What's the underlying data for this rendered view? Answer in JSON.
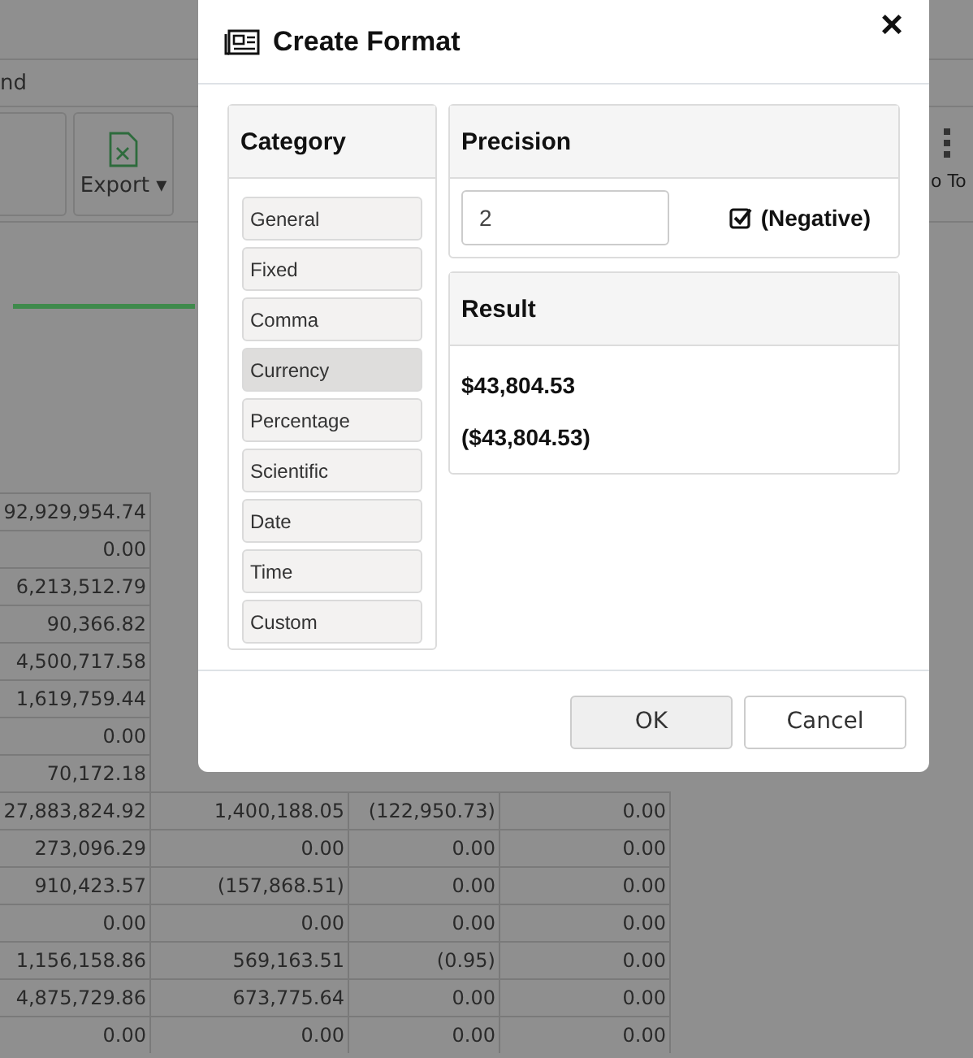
{
  "background": {
    "menu_text": "nd",
    "toolbar": {
      "export_label": "Export",
      "export_caret": "▾",
      "right_label": "o To"
    },
    "table": {
      "rows": [
        [
          "92,929,954.74"
        ],
        [
          "0.00"
        ],
        [
          "6,213,512.79"
        ],
        [
          "90,366.82"
        ],
        [
          "4,500,717.58"
        ],
        [
          "1,619,759.44"
        ],
        [
          "0.00"
        ],
        [
          "70,172.18"
        ],
        [
          "27,883,824.92",
          "1,400,188.05",
          "(122,950.73)",
          "0.00"
        ],
        [
          "273,096.29",
          "0.00",
          "0.00",
          "0.00"
        ],
        [
          "910,423.57",
          "(157,868.51)",
          "0.00",
          "0.00"
        ],
        [
          "0.00",
          "0.00",
          "0.00",
          "0.00"
        ],
        [
          "1,156,158.86",
          "569,163.51",
          "(0.95)",
          "0.00"
        ],
        [
          "4,875,729.86",
          "673,775.64",
          "0.00",
          "0.00"
        ],
        [
          "0.00",
          "0.00",
          "0.00",
          "0.00"
        ]
      ]
    }
  },
  "dialog": {
    "title": "Create Format",
    "close": "×",
    "category": {
      "title": "Category",
      "items": [
        {
          "label": "General",
          "selected": false
        },
        {
          "label": "Fixed",
          "selected": false
        },
        {
          "label": "Comma",
          "selected": false
        },
        {
          "label": "Currency",
          "selected": true
        },
        {
          "label": "Percentage",
          "selected": false
        },
        {
          "label": "Scientific",
          "selected": false
        },
        {
          "label": "Date",
          "selected": false
        },
        {
          "label": "Time",
          "selected": false
        },
        {
          "label": "Custom",
          "selected": false
        }
      ]
    },
    "precision": {
      "title": "Precision",
      "value": "2",
      "negative_label": "(Negative)",
      "negative_checked": true
    },
    "result": {
      "title": "Result",
      "values": [
        "$43,804.53",
        "($43,804.53)"
      ]
    },
    "buttons": [
      {
        "label": "OK",
        "kind": "primary"
      },
      {
        "label": "Cancel",
        "kind": "secondary"
      }
    ]
  }
}
